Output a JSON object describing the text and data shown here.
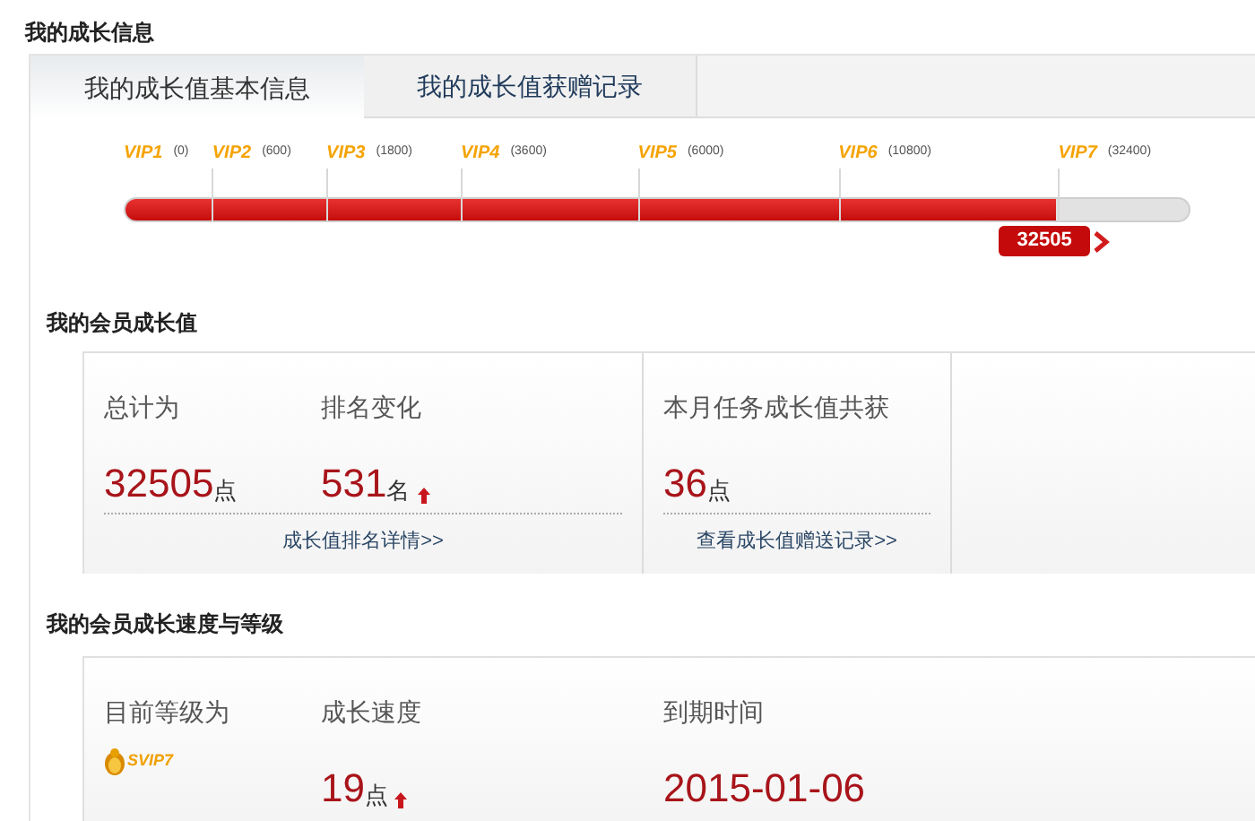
{
  "page_title": "我的成长信息",
  "tabs": [
    {
      "label": "我的成长值基本信息",
      "selected": true
    },
    {
      "label": "我的成长值获赠记录",
      "selected": false
    }
  ],
  "progress": {
    "level": 0.876,
    "badge": "32505",
    "milestones": [
      {
        "name": "VIP1",
        "points": "(0)"
      },
      {
        "name": "VIP2",
        "points": "(600)"
      },
      {
        "name": "VIP3",
        "points": "(1800)"
      },
      {
        "name": "VIP4",
        "points": "(3600)"
      },
      {
        "name": "VIP5",
        "points": "(6000)"
      },
      {
        "name": "VIP6",
        "points": "(10800)"
      },
      {
        "name": "VIP7",
        "points": "(32400)"
      }
    ]
  },
  "growth": {
    "title": "我的会员成长值",
    "stats": [
      {
        "label": "总计为",
        "value": "32505",
        "unit": "点",
        "trend_up": false
      },
      {
        "label": "排名变化",
        "value": "531",
        "unit": "名",
        "trend_up": true
      }
    ],
    "stats_link": "成长值排名详情>>",
    "monthly": {
      "label": "本月任务成长值共获",
      "value": "36",
      "unit": "点"
    },
    "monthly_link": "查看成长值赠送记录>>"
  },
  "speed": {
    "title": "我的会员成长速度与等级",
    "level_label": "目前等级为",
    "level_badge": "SVIP7",
    "speed_label": "成长速度",
    "speed_value": "19",
    "speed_unit": "点",
    "speed_up": true,
    "expiry_label": "到期时间",
    "expiry_value": "2015-01-06"
  }
}
